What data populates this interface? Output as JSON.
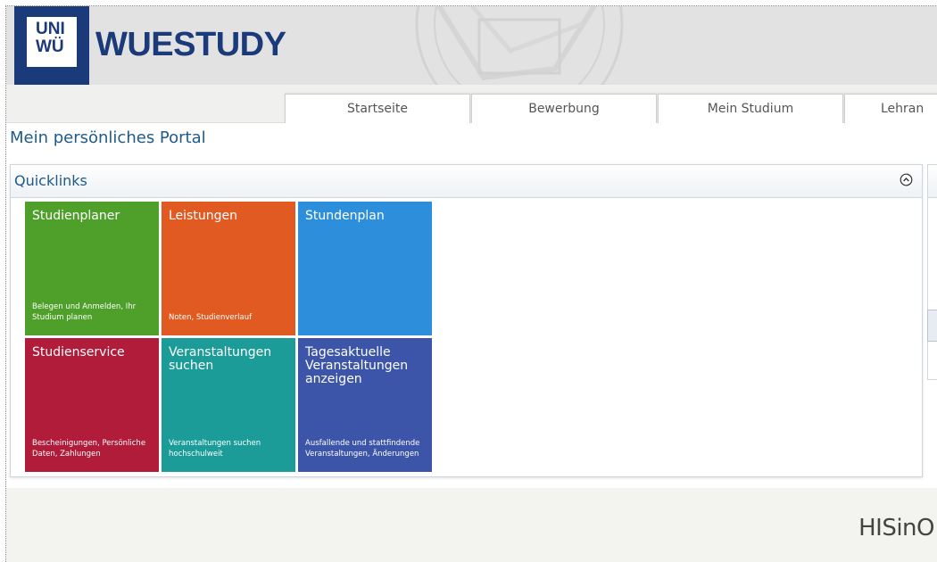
{
  "header": {
    "logo_line1": "UNI",
    "logo_line2": "WÜ",
    "brand": "WUESTUDY"
  },
  "nav": {
    "items": [
      {
        "label": "Startseite"
      },
      {
        "label": "Bewerbung"
      },
      {
        "label": "Mein Studium"
      },
      {
        "label": "Lehran"
      }
    ]
  },
  "page": {
    "title": "Mein persönliches Portal"
  },
  "quicklinks": {
    "title": "Quicklinks",
    "tiles": [
      {
        "title": "Studienplaner",
        "subtitle": "Belegen und Anmelden, Ihr Studium planen",
        "color": "#4ea02a"
      },
      {
        "title": "Leistungen",
        "subtitle": "Noten, Studienverlauf",
        "color": "#e05a22"
      },
      {
        "title": "Stundenplan",
        "subtitle": "",
        "color": "#2d8fdb"
      },
      {
        "title": "Studienservice",
        "subtitle": "Bescheinigungen, Persönliche Daten, Zahlungen",
        "color": "#b01c3a"
      },
      {
        "title": "Veranstaltungen suchen",
        "subtitle": "Veranstaltungen suchen hochschulweit",
        "color": "#1b9c98"
      },
      {
        "title": "Tagesaktuelle Veranstaltungen anzeigen",
        "subtitle": "Ausfallende und stattfindende Veranstaltungen, Änderungen",
        "color": "#3d55a8"
      }
    ]
  },
  "footer": {
    "brand": "HISinO"
  }
}
